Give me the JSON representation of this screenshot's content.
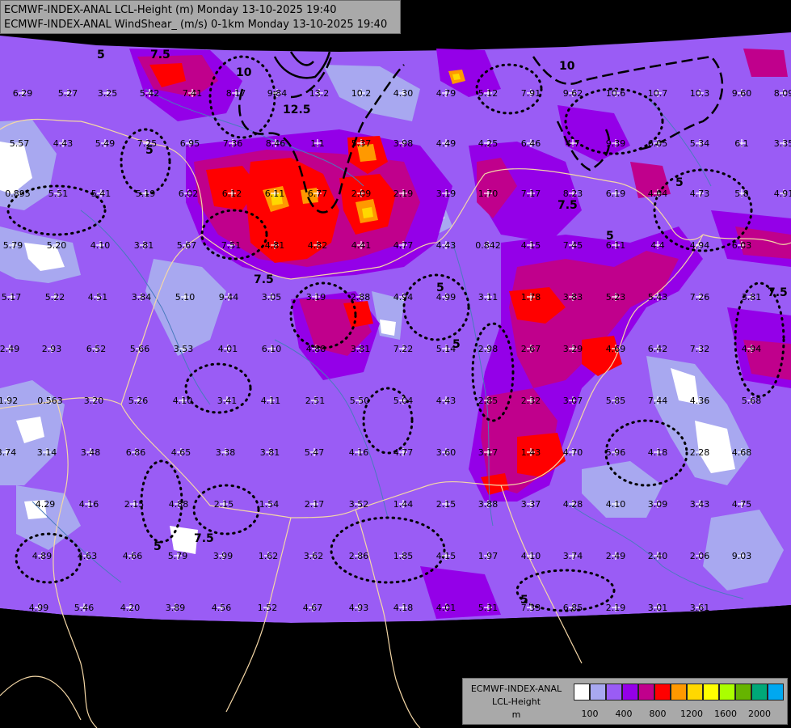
{
  "title": {
    "line1": "ECMWF-INDEX-ANAL LCL-Height (m) Monday 13-10-2025 19:40",
    "line2": "ECMWF-INDEX-ANAL WindShear_ (m/s) 0-1km Monday 13-10-2025 19:40"
  },
  "legend": {
    "line1": "ECMWF-INDEX-ANAL",
    "line2": "LCL-Height",
    "line3": "m",
    "colors": [
      "#ffffff",
      "#a8a8f0",
      "#9a5cf5",
      "#9400e8",
      "#c0008c",
      "#ff0000",
      "#ff9900",
      "#ffd800",
      "#ffff00",
      "#aaff00",
      "#66b400",
      "#00a878",
      "#00a8f0"
    ],
    "ticks": [
      "100",
      "400",
      "800",
      "1200",
      "1600",
      "2000"
    ]
  },
  "colors": {
    "background": "#000000",
    "base": "#9a5cf5",
    "light": "#a8a8f0",
    "dark": "#9400e8",
    "magenta": "#c0008c",
    "red": "#ff0000",
    "orange": "#ff9900",
    "yellow": "#ffd800",
    "border": "#f4d7a6",
    "river": "#4a7bbd"
  },
  "shear_contour_labels": [
    "5",
    "7.5",
    "10",
    "12.5",
    "5",
    "5",
    "7.5",
    "5",
    "7.5",
    "5",
    "10",
    "7.5",
    "5",
    "5",
    "7.5",
    "5"
  ],
  "point_values": [
    "6.29",
    "5.27",
    "3.25",
    "5.42",
    "7.41",
    "8.17",
    "9.84",
    "13.2",
    "10.2",
    "4.30",
    "4.79",
    "5.12",
    "7.91",
    "9.62",
    "10.6",
    "10.7",
    "10.3",
    "9.60",
    "8.09",
    "5.57",
    "4.43",
    "5.49",
    "7.25",
    "6.95",
    "7.36",
    "8.46",
    "1.1",
    "5.37",
    "3.98",
    "4.49",
    "4.25",
    "6.46",
    "4.7",
    "9.39",
    "6.05",
    "5.34",
    "6.1",
    "3.35",
    "0.895",
    "5.51",
    "5.41",
    "5.19",
    "6.02",
    "6.12",
    "6.11",
    "6.77",
    "2.09",
    "2.19",
    "3.19",
    "1.70",
    "7.17",
    "8.23",
    "6.19",
    "4.04",
    "4.73",
    "5.8",
    "4.91",
    "5.79",
    "5.20",
    "4.10",
    "3.81",
    "5.67",
    "7.51",
    "4.81",
    "4.82",
    "4.41",
    "4.77",
    "4.43",
    "0.842",
    "4.15",
    "7.45",
    "6.11",
    "4.4",
    "4.94",
    "6.03",
    "5.17",
    "5.22",
    "4.51",
    "3.84",
    "5.10",
    "9.44",
    "3.05",
    "3.19",
    "2.88",
    "4.94",
    "4.99",
    "3.11",
    "1.78",
    "3.83",
    "5.23",
    "5.43",
    "7.26",
    "3.81",
    "2.49",
    "2.93",
    "6.52",
    "5.66",
    "3.53",
    "4.01",
    "6.10",
    "4.88",
    "3.81",
    "7.22",
    "5.14",
    "2.98",
    "2.67",
    "3.29",
    "4.69",
    "6.42",
    "7.32",
    "4.94",
    "1.92",
    "0.563",
    "3.20",
    "5.26",
    "4.10",
    "3.41",
    "4.11",
    "2.51",
    "5.50",
    "5.04",
    "4.43",
    "2.85",
    "2.32",
    "3.07",
    "5.85",
    "7.44",
    "4.36",
    "5.68",
    "3.74",
    "3.14",
    "3.48",
    "6.86",
    "4.65",
    "3.38",
    "3.81",
    "5.47",
    "4.16",
    "4.77",
    "3.60",
    "3.17",
    "1.43",
    "4.70",
    "5.96",
    "4.18",
    "2.28",
    "4.68",
    "4.29",
    "4.16",
    "2.15",
    "4.88",
    "2.15",
    "1.54",
    "2.17",
    "3.52",
    "1.44",
    "2.15",
    "3.88",
    "3.37",
    "4.28",
    "4.10",
    "3.09",
    "3.43",
    "4.75",
    "4.89",
    "4.63",
    "4.66",
    "5.79",
    "3.99",
    "1.62",
    "3.62",
    "2.86",
    "1.85",
    "4.15",
    "1.97",
    "4.10",
    "3.74",
    "2.49",
    "2.40",
    "2.06",
    "9.03",
    "4.99",
    "5.46",
    "4.20",
    "3.89",
    "4.56",
    "1.52",
    "4.67",
    "4.93",
    "4.18",
    "4.01",
    "5.31",
    "7.33",
    "6.85",
    "2.19",
    "3.01",
    "3.61"
  ]
}
